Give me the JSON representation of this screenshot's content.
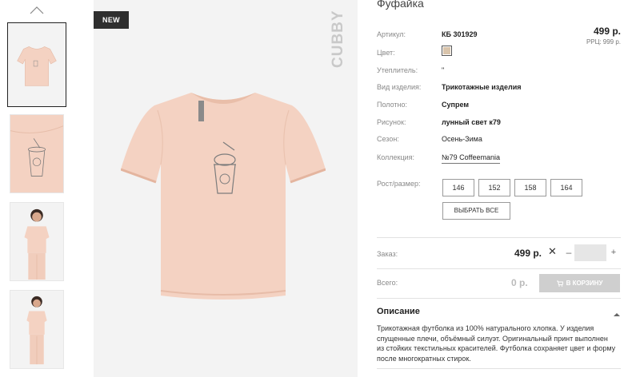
{
  "badge": "NEW",
  "brand": "CUBBY",
  "product": {
    "title": "Фуфайка",
    "price": "499 р.",
    "rrp_label": "РРЦ:",
    "rrp_value": "999 р."
  },
  "attributes": [
    {
      "label": "Артикул:",
      "value": "КБ 301929"
    },
    {
      "label": "Цвет:",
      "value": ""
    },
    {
      "label": "Утеплитель:",
      "value": "\""
    },
    {
      "label": "Вид изделия:",
      "value": "Трикотажные изделия"
    },
    {
      "label": "Полотно:",
      "value": "Супрем"
    },
    {
      "label": "Рисунок:",
      "value": "лунный свет к79"
    },
    {
      "label": "Сезон:",
      "value": "Осень-Зима"
    },
    {
      "label": "Коллекция:",
      "value": "№79 Coffeemania"
    }
  ],
  "colors": {
    "swatch": "#d9c4ab",
    "shirt": "#f4d2c2",
    "shirt_shadow": "#e9bea9",
    "cart_button": "#cfcfcf"
  },
  "sizes": {
    "label": "Рост/размер:",
    "options": [
      "146",
      "152",
      "158",
      "164"
    ],
    "select_all": "ВЫБРАТЬ ВСЕ"
  },
  "order": {
    "label": "Заказ:",
    "price": "499 р.",
    "multiply": "✕",
    "minus": "–",
    "quantity": "",
    "plus": "+"
  },
  "total": {
    "label": "Всего:",
    "value": "0 р.",
    "cart_button": "В КОРЗИНУ"
  },
  "description": {
    "heading": "Описание",
    "text": "Трикотажная футболка из 100% натурального хлопка. У изделия спущенные плечи, объёмный силуэт. Оригинальный принт выполнен из стойких текстильных красителей. Футболка сохраняет цвет и форму после многократных стирок."
  },
  "icons": [
    "chevron-up-icon",
    "cart-icon",
    "caret-up-icon"
  ]
}
